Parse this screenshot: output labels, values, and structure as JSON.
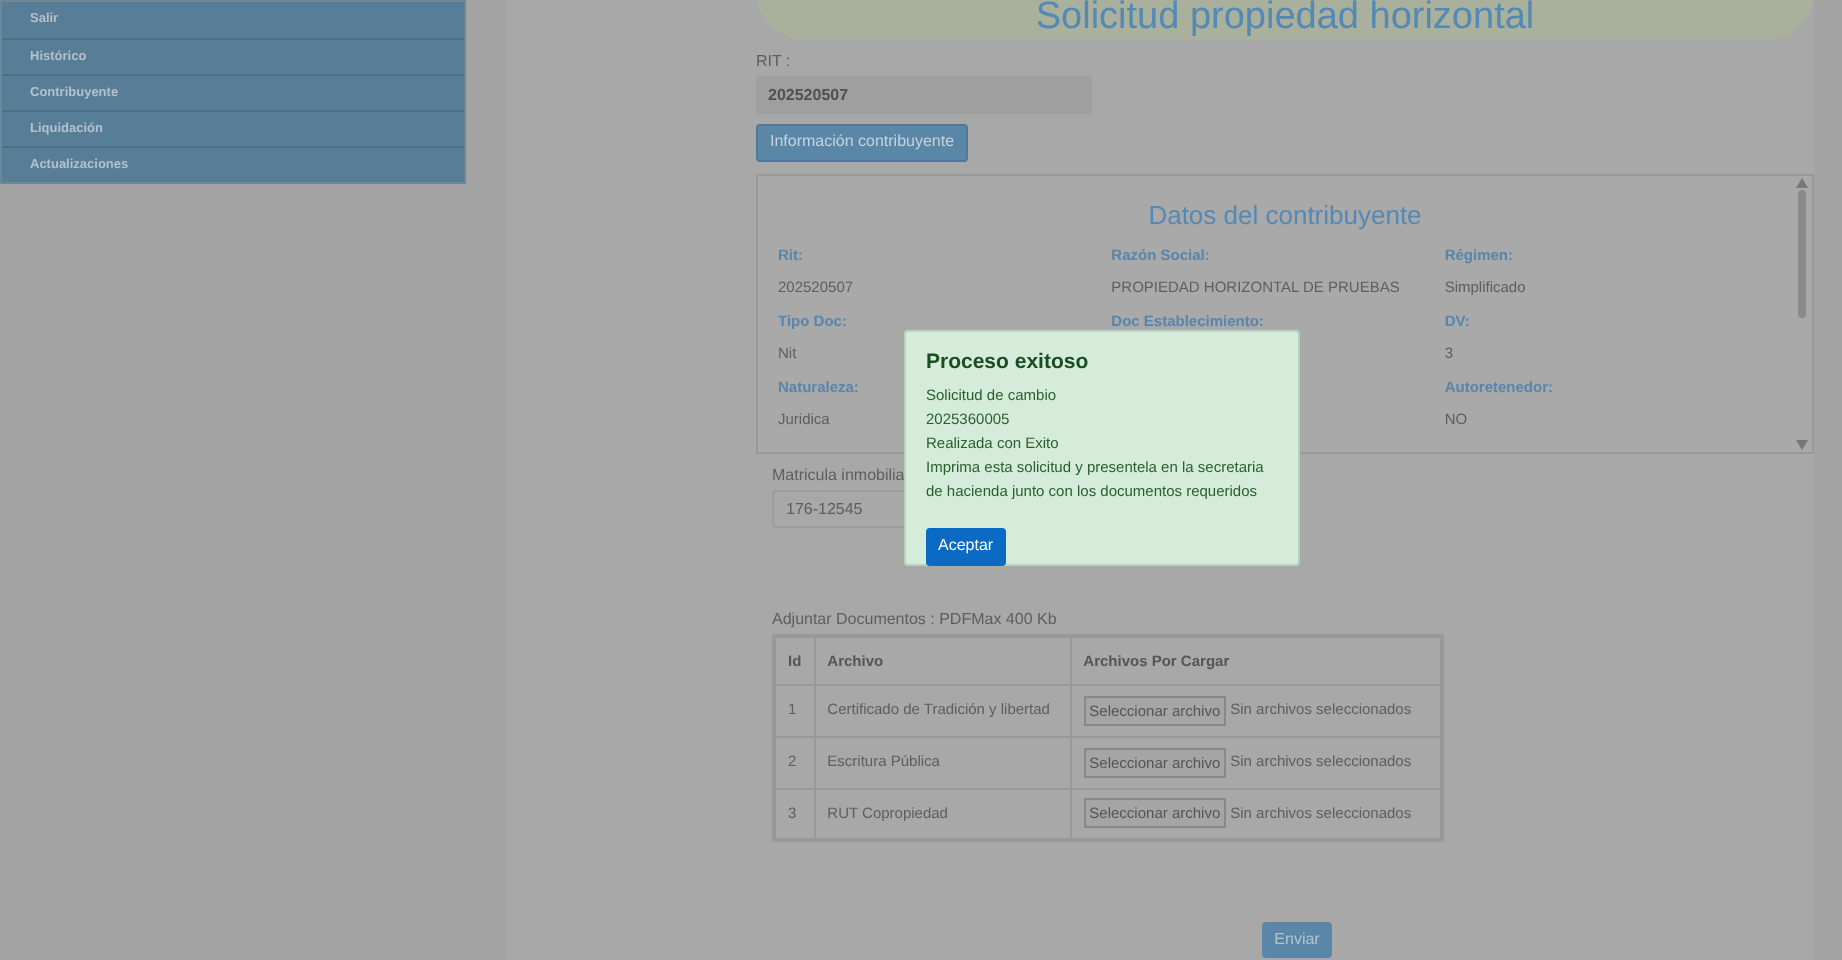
{
  "sidebar": {
    "items": [
      {
        "label": "Salir"
      },
      {
        "label": "Histórico"
      },
      {
        "label": "Contribuyente"
      },
      {
        "label": "Liquidación"
      },
      {
        "label": "Actualizaciones"
      }
    ]
  },
  "page_title": "Solicitud propiedad horizontal",
  "rit_field": {
    "label": "RIT :",
    "value": "202520507"
  },
  "info_button": "Información contribuyente",
  "taxpayer_card": {
    "title": "Datos del contribuyente",
    "fields": [
      {
        "label": "Rit:",
        "value": "202520507"
      },
      {
        "label": "Razón Social:",
        "value": "PROPIEDAD HORIZONTAL DE PRUEBAS"
      },
      {
        "label": "Régimen:",
        "value": "Simplificado"
      },
      {
        "label": "Tipo Doc:",
        "value": "Nit"
      },
      {
        "label": "Doc Establecimiento:"
      },
      {
        "label": "DV:",
        "value": "3"
      },
      {
        "label": "Naturaleza:",
        "value": "Juridica"
      },
      {
        "label": "Autoretenedor:",
        "value": "NO"
      }
    ]
  },
  "matricula_field": {
    "label": "Matricula inmobilia",
    "value": "176-12545"
  },
  "attachments": {
    "caption": "Adjuntar Documentos : PDFMax 400 Kb",
    "columns": [
      "Id",
      "Archivo",
      "Archivos Por Cargar"
    ],
    "rows": [
      {
        "id": "1",
        "name": "Certificado de Tradición y libertad",
        "button": "Seleccionar archivo",
        "status": "Sin archivos seleccionados"
      },
      {
        "id": "2",
        "name": "Escritura Pública",
        "button": "Seleccionar archivo",
        "status": "Sin archivos seleccionados"
      },
      {
        "id": "3",
        "name": "RUT Copropiedad",
        "button": "Seleccionar archivo",
        "status": "Sin archivos seleccionados"
      }
    ]
  },
  "submit_button": "Enviar",
  "dialog": {
    "title": "Proceso exitoso",
    "lines": [
      "Solicitud de cambio",
      "2025360005",
      "Realizada con Exito",
      "Imprima esta solicitud y presentela en la secretaria de hacienda junto con los documentos requeridos"
    ],
    "button": "Aceptar"
  }
}
